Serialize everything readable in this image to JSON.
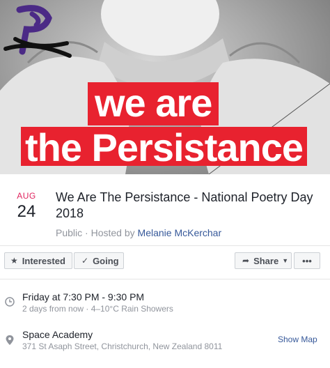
{
  "cover": {
    "line1": "we are",
    "line2": "the Persistance"
  },
  "event": {
    "month": "AUG",
    "day": "24",
    "title": "We Are The Persistance - National Poetry Day 2018",
    "privacy": "Public",
    "hosted_prefix": "Hosted by",
    "host": "Melanie McKerchar"
  },
  "actions": {
    "interested": "Interested",
    "going": "Going",
    "share": "Share",
    "more": "•••"
  },
  "details": {
    "time": "Friday at 7:30 PM - 9:30 PM",
    "time_sub": "2 days from now · 4–10°C Rain Showers",
    "venue": "Space Academy",
    "address": "371 St Asaph Street, Christchurch, New Zealand 8011",
    "show_map": "Show Map"
  },
  "colors": {
    "banner_red": "#e8222f",
    "scribble_purple": "#4b2a86",
    "date_pink": "#e0245e",
    "link_blue": "#365899"
  },
  "icons": [
    "star-icon",
    "check-icon",
    "share-icon",
    "chevron-down-icon",
    "more-icon",
    "clock-icon",
    "map-pin-icon"
  ]
}
